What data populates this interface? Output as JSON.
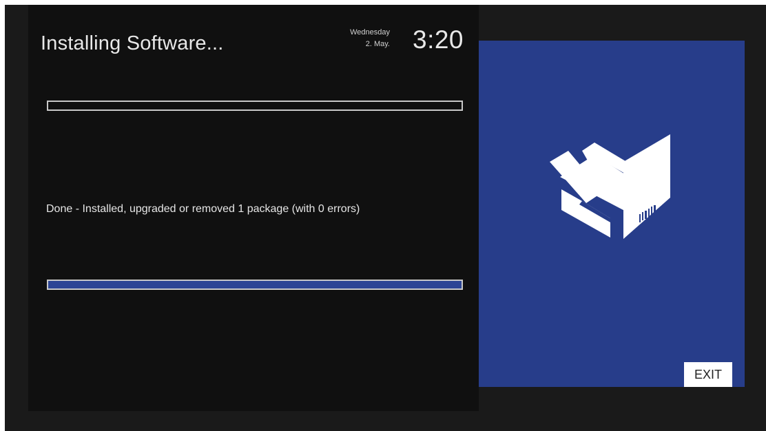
{
  "header": {
    "title": "Installing Software...",
    "clock": {
      "weekday": "Wednesday",
      "date": "2. May.",
      "time": "3:20"
    }
  },
  "main": {
    "status": "Done - Installed, upgraded or removed 1 package (with 0 errors)",
    "progress_top": 0,
    "progress_bottom": 100
  },
  "side_panel": {
    "icon": "package-box-icon",
    "exit_label": "EXIT"
  },
  "colors": {
    "accent": "#273d8a",
    "progress_fill": "#2d4595",
    "background": "#101010"
  }
}
